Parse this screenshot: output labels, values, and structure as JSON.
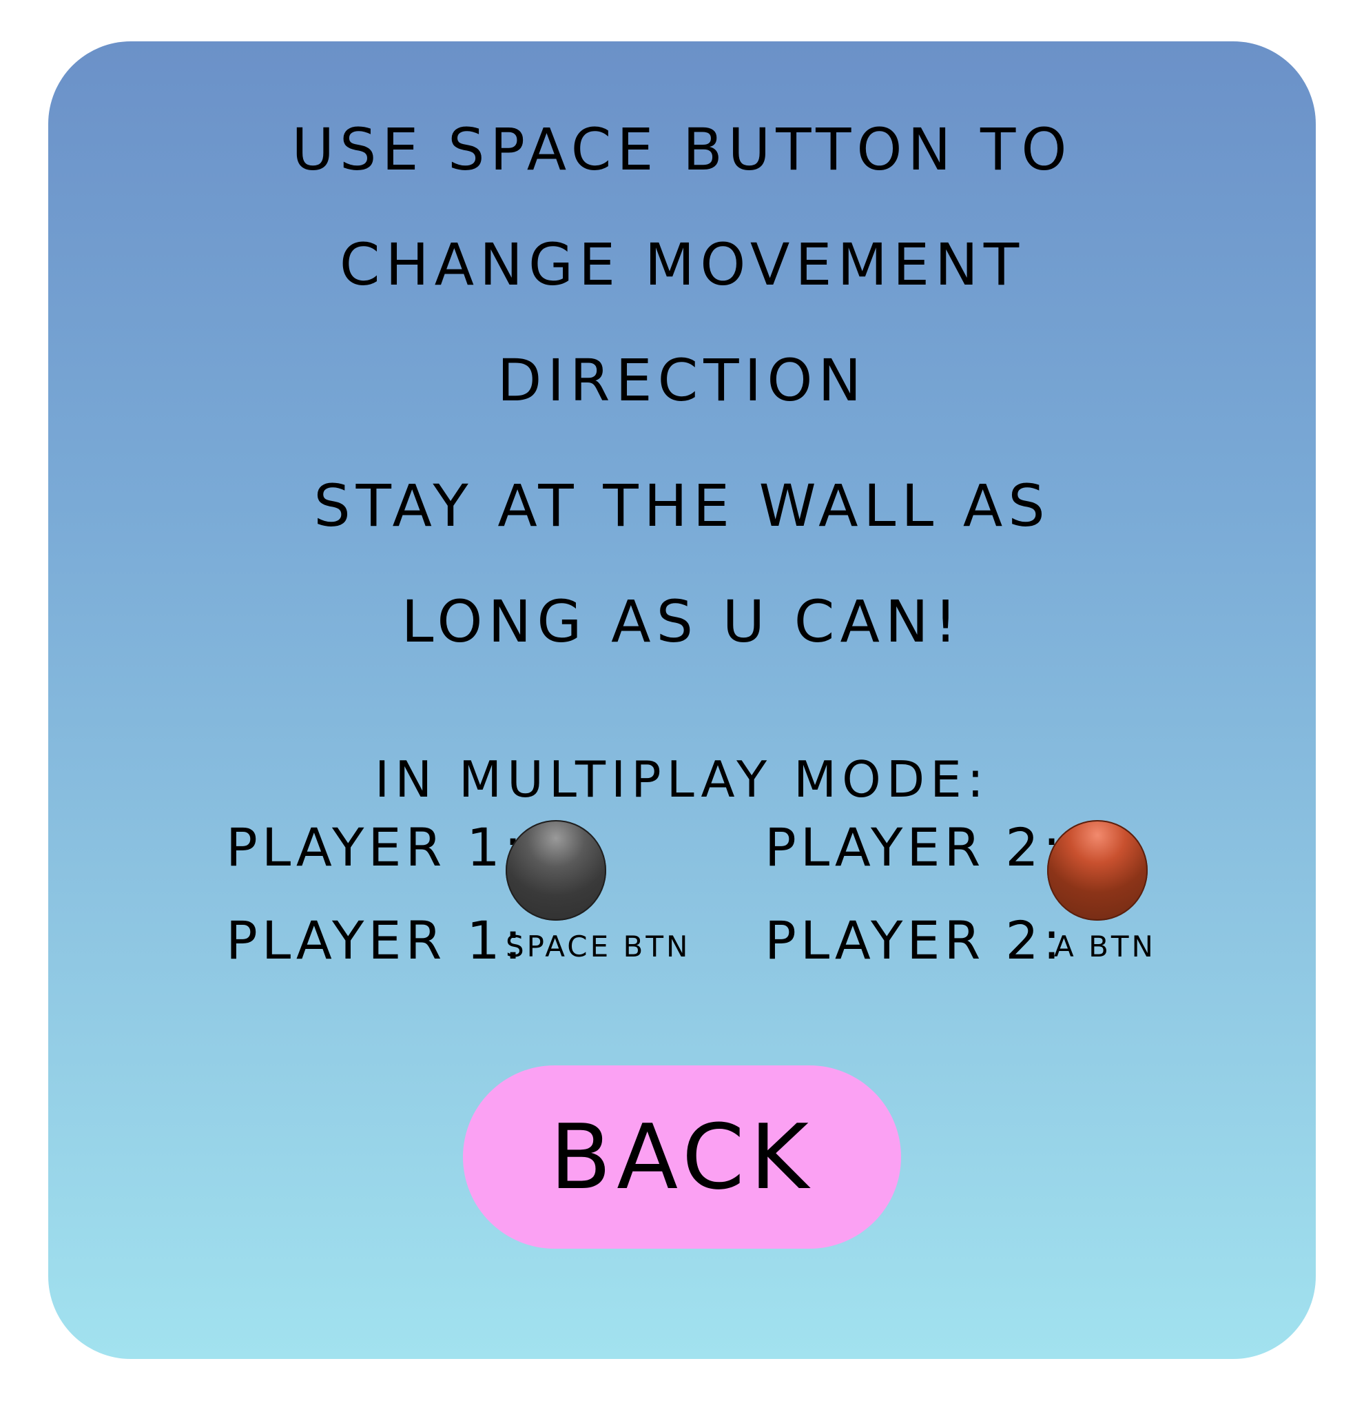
{
  "instructions": {
    "line1": "USE SPACE BUTTON TO",
    "line2": "CHANGE MOVEMENT",
    "line3": "DIRECTION",
    "line4": "STAY AT THE WALL AS",
    "line5": "LONG AS U CAN!"
  },
  "multiplay": {
    "heading": "IN MULTIPLAY MODE:",
    "player1": {
      "label": "PLAYER 1:",
      "ball_color": "#3a3a3a",
      "control_label": "PLAYER 1:",
      "control_key": "SPACE BTN"
    },
    "player2": {
      "label": "PLAYER 2:",
      "ball_color": "#8c3418",
      "control_label": "PLAYER 2:",
      "control_key": "A BTN"
    }
  },
  "back_button": {
    "label": "BACK",
    "color": "#fba1f3"
  },
  "panel_gradient": {
    "top": "#6b91c8",
    "bottom": "#a2e2ef"
  }
}
